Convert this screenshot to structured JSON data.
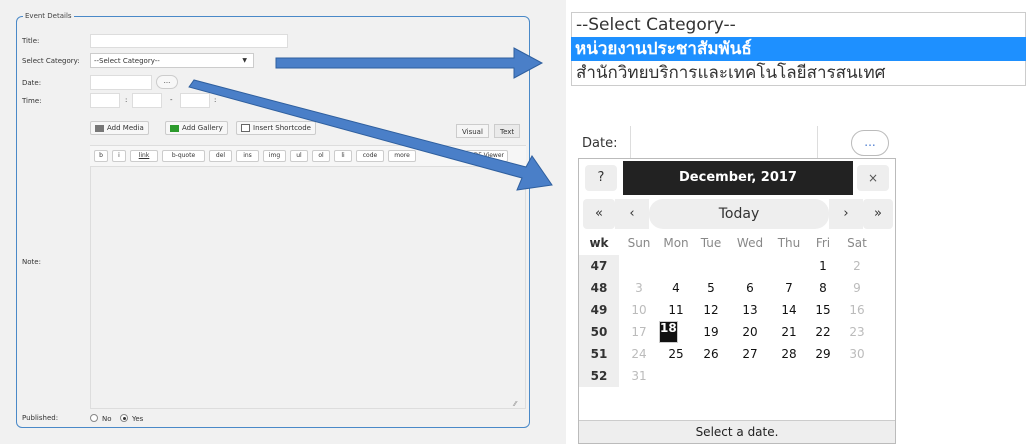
{
  "form": {
    "legend": "Event Details",
    "title_label": "Title:",
    "category_label": "Select Category:",
    "category_value": "--Select Category--",
    "date_label": "Date:",
    "date_button": "...",
    "time_label": "Time:",
    "time_sep_colon": ":",
    "time_sep_dash": "-",
    "note_label": "Note:",
    "published_label": "Published:",
    "published_options": [
      "No",
      "Yes"
    ],
    "published_selected": "Yes"
  },
  "editor": {
    "add_media": "Add Media",
    "add_gallery": "Add Gallery",
    "insert_shortcode": "Insert Shortcode",
    "tab_visual": "Visual",
    "tab_text": "Text",
    "quicktags": [
      "b",
      "i",
      "link",
      "b-quote",
      "del",
      "ins",
      "img",
      "ul",
      "ol",
      "li",
      "code",
      "more"
    ],
    "pdf_viewer": "PDF Viewer"
  },
  "dropdown_zoom": {
    "options": [
      "--Select Category--",
      "หน่วยงานประชาสัมพันธ์",
      "สำนักวิทยบริการและเทคโนโลยีสารสนเทศ"
    ],
    "highlighted_index": 1
  },
  "calendar": {
    "date_label": "Date:",
    "open_button": "...",
    "help": "?",
    "title": "December, 2017",
    "close": "×",
    "prev_year": "«",
    "prev_month": "‹",
    "today": "Today",
    "next_month": "›",
    "next_year": "»",
    "headers": [
      "wk",
      "Sun",
      "Mon",
      "Tue",
      "Wed",
      "Thu",
      "Fri",
      "Sat"
    ],
    "weeks": [
      {
        "wk": "47",
        "days": [
          "",
          "",
          "",
          "",
          "",
          "1",
          "2"
        ],
        "other": [
          false,
          false,
          false,
          false,
          false,
          false,
          true
        ]
      },
      {
        "wk": "48",
        "days": [
          "3",
          "4",
          "5",
          "6",
          "7",
          "8",
          "9"
        ],
        "other": [
          true,
          false,
          false,
          false,
          false,
          false,
          true
        ]
      },
      {
        "wk": "49",
        "days": [
          "10",
          "11",
          "12",
          "13",
          "14",
          "15",
          "16"
        ],
        "other": [
          true,
          false,
          false,
          false,
          false,
          false,
          true
        ]
      },
      {
        "wk": "50",
        "days": [
          "17",
          "18",
          "19",
          "20",
          "21",
          "22",
          "23"
        ],
        "other": [
          true,
          false,
          false,
          false,
          false,
          false,
          true
        ]
      },
      {
        "wk": "51",
        "days": [
          "24",
          "25",
          "26",
          "27",
          "28",
          "29",
          "30"
        ],
        "other": [
          true,
          false,
          false,
          false,
          false,
          false,
          true
        ]
      },
      {
        "wk": "52",
        "days": [
          "31",
          "",
          "",
          "",
          "",
          "",
          ""
        ],
        "other": [
          true,
          false,
          false,
          false,
          false,
          false,
          false
        ]
      }
    ],
    "selected_day": "18",
    "footer": "Select a date."
  },
  "colors": {
    "accent": "#1e90ff",
    "arrow": "#4a7fc8",
    "border": "#4a89c8",
    "calendar_header": "#222222"
  }
}
